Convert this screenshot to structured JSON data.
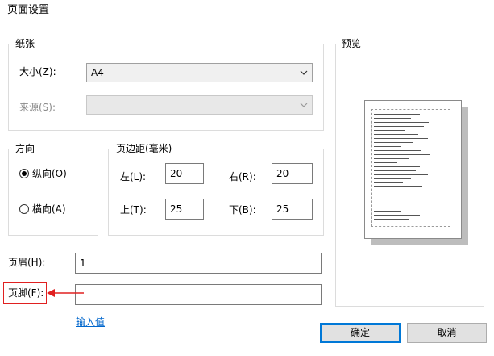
{
  "window": {
    "title": "页面设置"
  },
  "paper": {
    "legend": "纸张",
    "size_label": "大小(Z):",
    "size_value": "A4",
    "source_label": "来源(S):",
    "source_value": ""
  },
  "orientation": {
    "legend": "方向",
    "portrait_label": "纵向(O)",
    "landscape_label": "横向(A)",
    "selected": "portrait"
  },
  "margins": {
    "legend": "页边距(毫米)",
    "left_label": "左(L):",
    "left_value": "20",
    "right_label": "右(R):",
    "right_value": "20",
    "top_label": "上(T):",
    "top_value": "25",
    "bottom_label": "下(B):",
    "bottom_value": "25"
  },
  "header": {
    "label": "页眉(H):",
    "value": "1"
  },
  "footer": {
    "label": "页脚(F):",
    "value": ""
  },
  "input_values_link": "输入值",
  "preview": {
    "legend": "预览"
  },
  "buttons": {
    "ok": "确定",
    "cancel": "取消"
  },
  "colors": {
    "accent": "#0078d7",
    "annotation": "#e02020",
    "link": "#0066cc"
  }
}
